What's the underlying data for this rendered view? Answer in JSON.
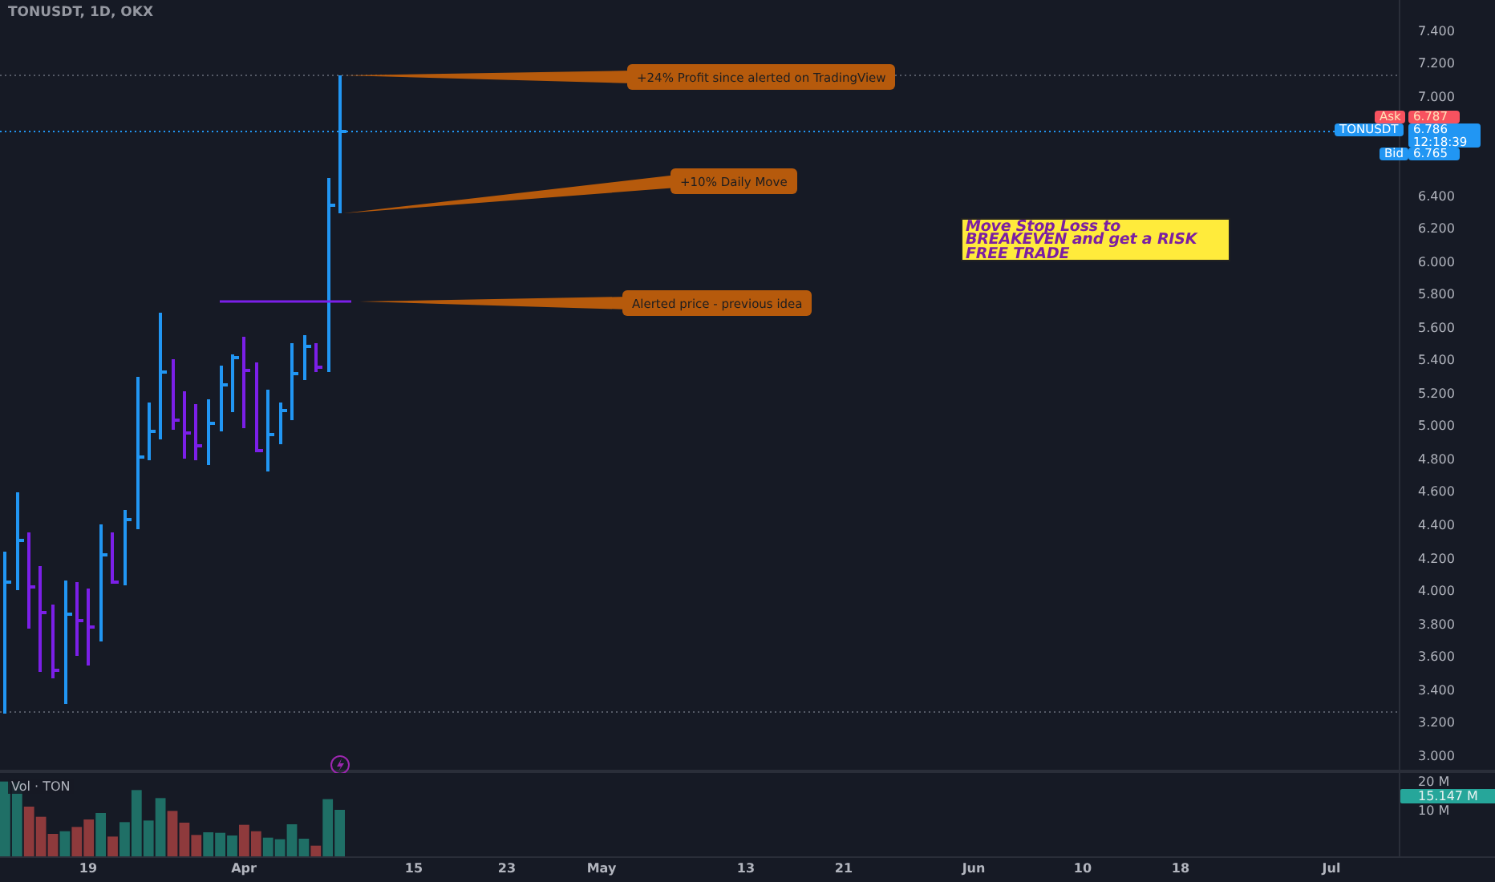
{
  "chart_title": "TONUSDT, 1D, OKX",
  "callouts": [
    {
      "text": "+24% Profit since alerted on TradingView"
    },
    {
      "text": "+10% Daily Move"
    },
    {
      "text": "Alerted price - previous idea"
    }
  ],
  "note": {
    "text": "Move Stop Loss to BREAKEVEN and get a RISK FREE TRADE"
  },
  "price_axis": {
    "upper_labels": [
      "7.400",
      "7.200",
      "7.000"
    ],
    "lower_labels": [
      "6.400",
      "6.200",
      "6.000",
      "5.800",
      "5.600",
      "5.400",
      "5.200",
      "5.000",
      "4.800",
      "4.600",
      "4.400",
      "4.200",
      "4.000",
      "3.800",
      "3.600",
      "3.400",
      "3.200",
      "3.000"
    ]
  },
  "badges": [
    {
      "kind": "ask",
      "label": "Ask",
      "value": "6.787"
    },
    {
      "kind": "last",
      "label": "TONUSDT",
      "value": "6.786",
      "countdown": "12:18:39"
    },
    {
      "kind": "bid",
      "label": "Bid",
      "value": "6.765"
    }
  ],
  "volume_pane": {
    "title": "Vol · TON",
    "axis_labels": [
      "20 M",
      "10 M"
    ],
    "current": "15.147 M"
  },
  "time_axis": [
    "19",
    "Apr",
    "15",
    "23",
    "May",
    "13",
    "21",
    "Jun",
    "10",
    "18",
    "Jul"
  ]
}
